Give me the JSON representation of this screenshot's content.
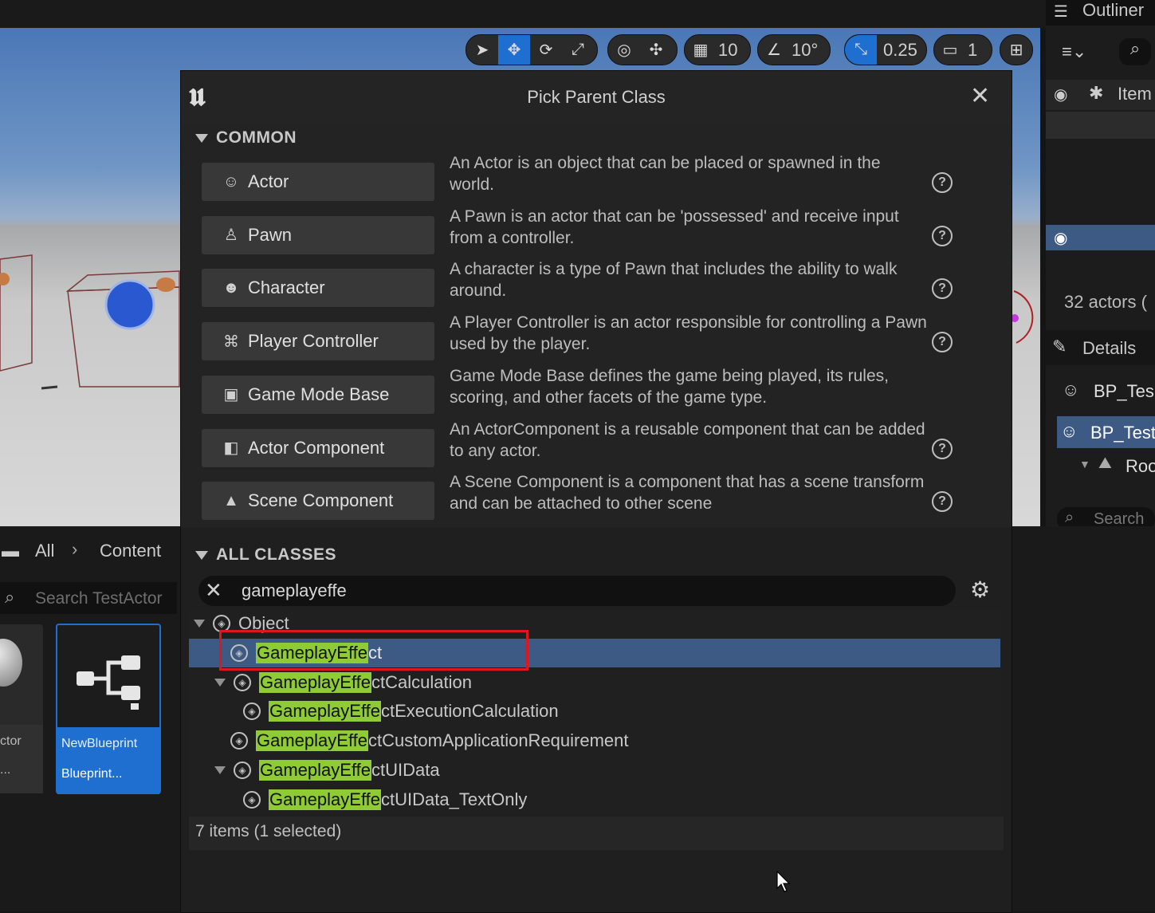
{
  "toolbar": {
    "grid_value": "10",
    "angle_value": "10°",
    "scale_value": "0.25",
    "camera_value": "1"
  },
  "outliner": {
    "title": "Outliner",
    "column_item": "Item",
    "actor_count": "32 actors (",
    "details_title": "Details",
    "details_item1": "BP_Tes",
    "details_item2": "BP_Test",
    "details_item3": "Roo",
    "search_placeholder": "Search"
  },
  "content_browser": {
    "path_all": "All",
    "path_content": "Content",
    "search_placeholder": "Search TestActor",
    "asset1_label": "ctor",
    "asset1_sub": "...",
    "asset2_label": "NewBlueprint",
    "asset2_sub": "Blueprint..."
  },
  "dialog": {
    "title": "Pick Parent Class",
    "common_header": "COMMON",
    "all_classes_header": "ALL CLASSES",
    "common_classes": [
      {
        "label": "Actor",
        "icon": "actor-icon",
        "desc": "An Actor is an object that can be placed or spawned in the world."
      },
      {
        "label": "Pawn",
        "icon": "pawn-icon",
        "desc": "A Pawn is an actor that can be 'possessed' and receive input from a controller."
      },
      {
        "label": "Character",
        "icon": "character-icon",
        "desc": "A character is a type of Pawn that includes the ability to walk around."
      },
      {
        "label": "Player Controller",
        "icon": "gamepad-icon",
        "desc": "A Player Controller is an actor responsible for controlling a Pawn used by the player."
      },
      {
        "label": "Game Mode Base",
        "icon": "gamemode-icon",
        "desc": "Game Mode Base defines the game being played, its rules, scoring, and other facets of the game type."
      },
      {
        "label": "Actor Component",
        "icon": "component-icon",
        "desc": "An ActorComponent is a reusable component that can be added to any actor."
      },
      {
        "label": "Scene Component",
        "icon": "scene-component-icon",
        "desc": "A Scene Component is a component that has a scene transform and can be attached to other scene"
      }
    ],
    "search_value": "gameplayeffe",
    "tree_root": "Object",
    "tree_items": [
      {
        "match": "GameplayEffe",
        "rest": "ct"
      },
      {
        "match": "GameplayEffe",
        "rest": "ctCalculation"
      },
      {
        "match": "GameplayEffe",
        "rest": "ctExecutionCalculation"
      },
      {
        "match": "GameplayEffe",
        "rest": "ctCustomApplicationRequirement"
      },
      {
        "match": "GameplayEffe",
        "rest": "ctUIData"
      },
      {
        "match": "GameplayEffe",
        "rest": "ctUIData_TextOnly"
      }
    ],
    "status": "7 items (1 selected)"
  },
  "colors": {
    "accent": "#1f6fd1",
    "highlight": "#8fcb35",
    "selection": "#3d5a85",
    "annotation_box": "#e0161c"
  }
}
